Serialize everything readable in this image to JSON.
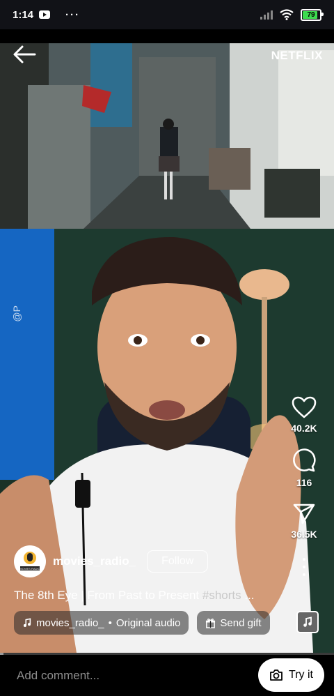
{
  "status_bar": {
    "time": "1:14",
    "more": "···",
    "battery_percent": "79",
    "battery_level": 0.79
  },
  "video": {
    "brand": "NETFLIX",
    "watermark": "@P"
  },
  "actions": {
    "likes": "40.2K",
    "comments": "116",
    "shares": "36.5K"
  },
  "author": {
    "username": "movies_radio_",
    "follow_label": "Follow",
    "avatar_text": "MOVIES RADIO"
  },
  "caption": {
    "text": "The 8th Eye | From Past to Present",
    "hashtag": "#shorts",
    "ellipsis": "..."
  },
  "audio": {
    "artist": "movies_radio_",
    "separator": "•",
    "title": "Original audio"
  },
  "gift": {
    "label": "Send gift"
  },
  "playback": {
    "progress": 0.01
  },
  "comment_bar": {
    "placeholder": "Add comment...",
    "try_label": "Try it"
  },
  "colors": {
    "accent_battery": "#3ddc4f",
    "background": "#000000"
  }
}
